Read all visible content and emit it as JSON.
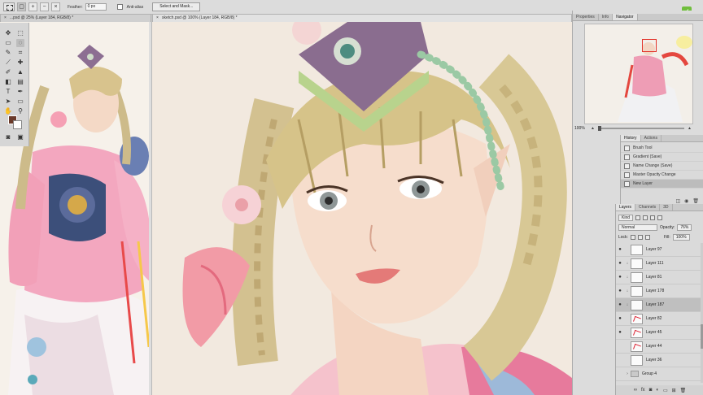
{
  "options_bar": {
    "feather_label": "Feather:",
    "feather_value": "0 px",
    "antialias_label": "Anti-alias",
    "select_mask_label": "Select and Mask..."
  },
  "tabs": {
    "reference": "...psd @ 25% (Layer 184, RGB/8) *",
    "sketch": "sketch.psd @ 100% (Layer 184, RGB/8) *"
  },
  "colors": {
    "foreground": "#6b3a2a",
    "background": "#ffffff",
    "accent_green": "#6fbe3c"
  },
  "navigator": {
    "tabs": [
      "Properties",
      "Info",
      "Navigator"
    ],
    "active_tab": "Navigator",
    "zoom": "100%"
  },
  "history": {
    "tabs": [
      "History",
      "Actions"
    ],
    "items": [
      {
        "label": "Brush Tool"
      },
      {
        "label": "Gradient (Save)"
      },
      {
        "label": "Name Change (Save)"
      },
      {
        "label": "Master Opacity Change"
      },
      {
        "label": "New Layer"
      }
    ]
  },
  "layers": {
    "tabs": [
      "Layers",
      "Channels",
      "3D"
    ],
    "filter_kind": "Kind",
    "blend_mode": "Normal",
    "opacity_label": "Opacity:",
    "opacity_value": "76%",
    "lock_label": "Lock:",
    "fill_label": "Fill:",
    "fill_value": "100%",
    "items": [
      {
        "name": "Layer 97"
      },
      {
        "name": "Layer 111"
      },
      {
        "name": "Layer 81"
      },
      {
        "name": "Layer 178"
      },
      {
        "name": "Layer 187"
      },
      {
        "name": "Layer 82"
      },
      {
        "name": "Layer 45"
      },
      {
        "name": "Layer 44"
      },
      {
        "name": "Layer 36"
      },
      {
        "name": "Group 4"
      }
    ]
  }
}
